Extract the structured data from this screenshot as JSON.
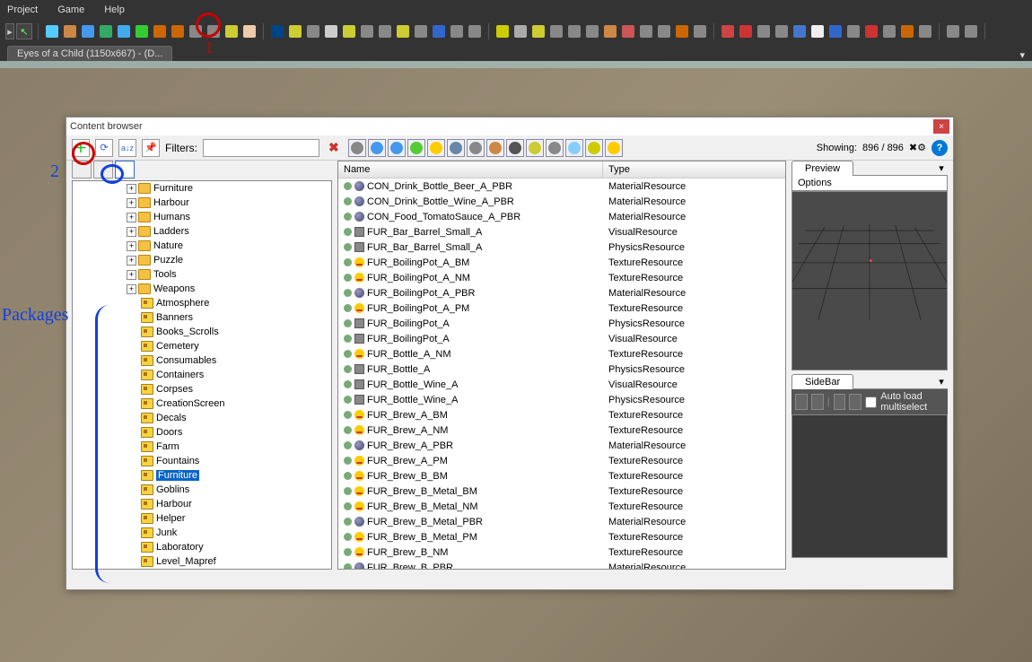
{
  "menu": {
    "items": [
      "Project",
      "Game",
      "Help"
    ]
  },
  "doctab": {
    "title": "Eyes of a Child (1150x667) - (D...",
    "close": "×"
  },
  "window": {
    "title": "Content browser",
    "close": "×"
  },
  "toolbar": {
    "filters_label": "Filters:",
    "filters_value": "",
    "showing_label": "Showing:",
    "showing_count": "896 / 896"
  },
  "tree": {
    "folders": [
      "Furniture",
      "Harbour",
      "Humans",
      "Ladders",
      "Nature",
      "Puzzle",
      "Tools",
      "Weapons"
    ],
    "packages": [
      "Atmosphere",
      "Banners",
      "Books_Scrolls",
      "Cemetery",
      "Consumables",
      "Containers",
      "Corpses",
      "CreationScreen",
      "Decals",
      "Doors",
      "Farm",
      "Fountains",
      "Furniture",
      "Goblins",
      "Harbour",
      "Helper",
      "Junk",
      "Laboratory",
      "Level_Mapref"
    ],
    "selected": "Furniture"
  },
  "list": {
    "cols": {
      "name": "Name",
      "type": "Type"
    },
    "rows": [
      {
        "name": "CON_Drink_Bottle_Beer_A_PBR",
        "type": "MaterialResource",
        "icon": "sphere"
      },
      {
        "name": "CON_Drink_Bottle_Wine_A_PBR",
        "type": "MaterialResource",
        "icon": "sphere"
      },
      {
        "name": "CON_Food_TomatoSauce_A_PBR",
        "type": "MaterialResource",
        "icon": "sphere"
      },
      {
        "name": "FUR_Bar_Barrel_Small_A",
        "type": "VisualResource",
        "icon": "cube"
      },
      {
        "name": "FUR_Bar_Barrel_Small_A",
        "type": "PhysicsResource",
        "icon": "cube"
      },
      {
        "name": "FUR_BoilingPot_A_BM",
        "type": "TextureResource",
        "icon": "emoji"
      },
      {
        "name": "FUR_BoilingPot_A_NM",
        "type": "TextureResource",
        "icon": "emoji"
      },
      {
        "name": "FUR_BoilingPot_A_PBR",
        "type": "MaterialResource",
        "icon": "sphere"
      },
      {
        "name": "FUR_BoilingPot_A_PM",
        "type": "TextureResource",
        "icon": "emoji"
      },
      {
        "name": "FUR_BoilingPot_A",
        "type": "PhysicsResource",
        "icon": "cube"
      },
      {
        "name": "FUR_BoilingPot_A",
        "type": "VisualResource",
        "icon": "cube"
      },
      {
        "name": "FUR_Bottle_A_NM",
        "type": "TextureResource",
        "icon": "emoji"
      },
      {
        "name": "FUR_Bottle_A",
        "type": "PhysicsResource",
        "icon": "cube"
      },
      {
        "name": "FUR_Bottle_Wine_A",
        "type": "VisualResource",
        "icon": "cube"
      },
      {
        "name": "FUR_Bottle_Wine_A",
        "type": "PhysicsResource",
        "icon": "cube"
      },
      {
        "name": "FUR_Brew_A_BM",
        "type": "TextureResource",
        "icon": "emoji"
      },
      {
        "name": "FUR_Brew_A_NM",
        "type": "TextureResource",
        "icon": "emoji"
      },
      {
        "name": "FUR_Brew_A_PBR",
        "type": "MaterialResource",
        "icon": "sphere"
      },
      {
        "name": "FUR_Brew_A_PM",
        "type": "TextureResource",
        "icon": "emoji"
      },
      {
        "name": "FUR_Brew_B_BM",
        "type": "TextureResource",
        "icon": "emoji"
      },
      {
        "name": "FUR_Brew_B_Metal_BM",
        "type": "TextureResource",
        "icon": "emoji"
      },
      {
        "name": "FUR_Brew_B_Metal_NM",
        "type": "TextureResource",
        "icon": "emoji"
      },
      {
        "name": "FUR_Brew_B_Metal_PBR",
        "type": "MaterialResource",
        "icon": "sphere"
      },
      {
        "name": "FUR_Brew_B_Metal_PM",
        "type": "TextureResource",
        "icon": "emoji"
      },
      {
        "name": "FUR_Brew_B_NM",
        "type": "TextureResource",
        "icon": "emoji"
      },
      {
        "name": "FUR_Brew_B_PBR",
        "type": "MaterialResource",
        "icon": "sphere"
      }
    ]
  },
  "preview": {
    "tab": "Preview",
    "options": "Options"
  },
  "sidebar": {
    "tab": "SideBar",
    "checkbox": "Auto load multiselect"
  },
  "annotations": {
    "one": "1",
    "two": "2",
    "packages": "Packages"
  },
  "icons": {
    "toolbar_colors": [
      "#5cf",
      "#c84",
      "#49e",
      "#3a6",
      "#4ae",
      "#3c3",
      "#c60",
      "#c60",
      "#888",
      "#888",
      "#cc3",
      "#eca",
      "#048",
      "#cc3",
      "#888",
      "#ccc",
      "#cc3",
      "#888",
      "#888",
      "#cc3",
      "#888",
      "#36c",
      "#888",
      "#888",
      "#cc0",
      "#aaa",
      "#cc3",
      "#888",
      "#888",
      "#888",
      "#c84",
      "#c55",
      "#888",
      "#888",
      "#c60",
      "#888",
      "#c44",
      "#c33",
      "#888",
      "#888",
      "#47c",
      "#eee",
      "#36c",
      "#888",
      "#c33",
      "#888",
      "#c60",
      "#888",
      "#888",
      "#888"
    ],
    "filter_colors": [
      "#888",
      "#49e",
      "#49e",
      "#5c3",
      "#fc0",
      "#68a",
      "#888",
      "#c84",
      "#555",
      "#cc3",
      "#888",
      "#8cf",
      "#cc0",
      "#fc0"
    ]
  }
}
